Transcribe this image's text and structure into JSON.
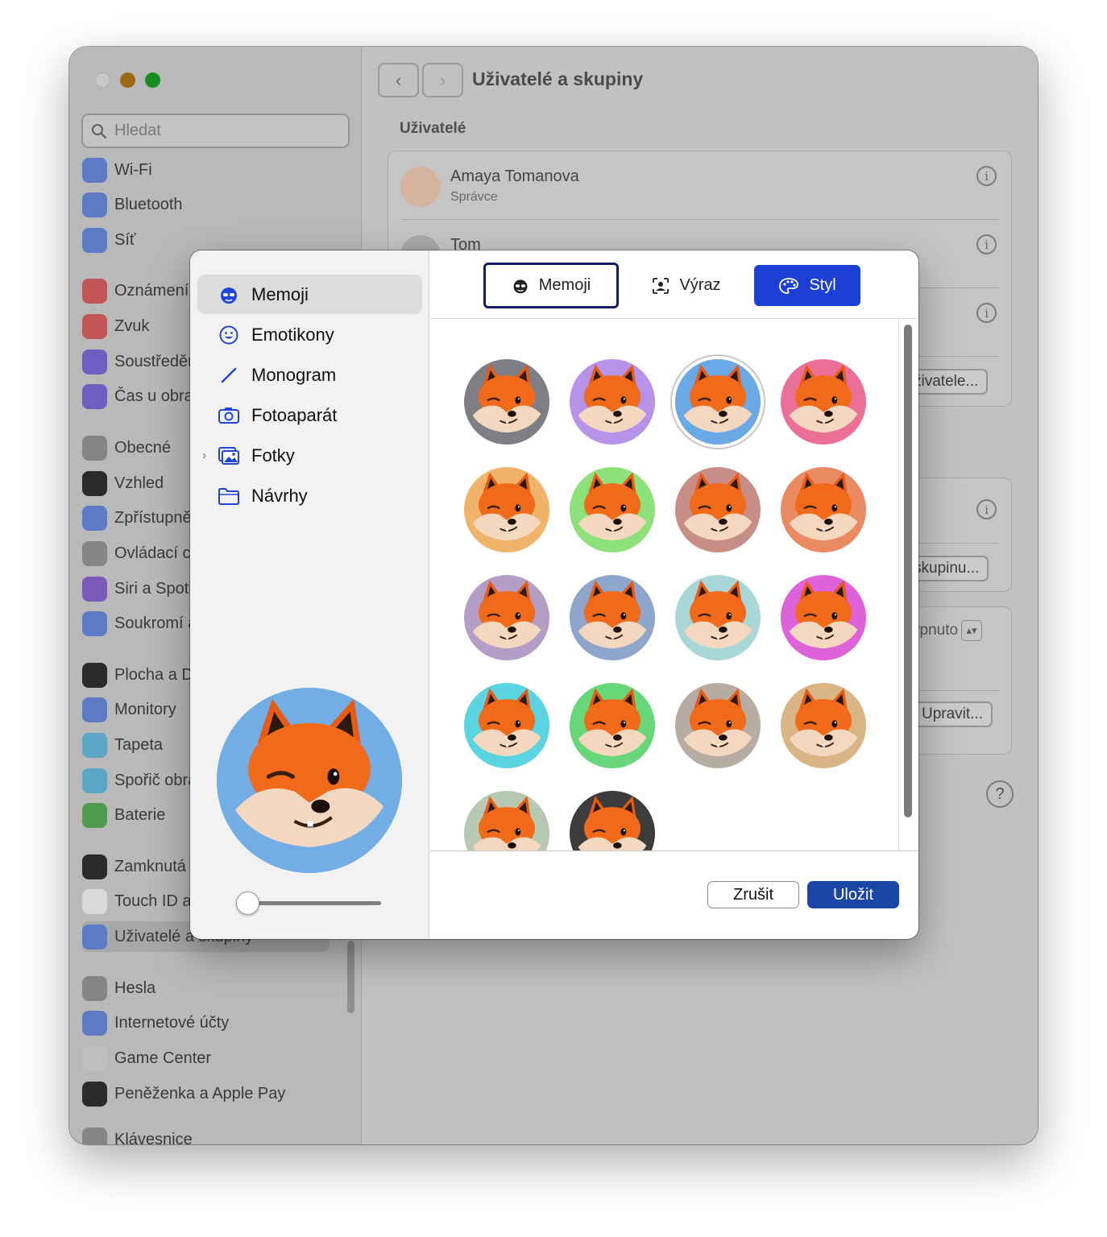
{
  "window": {
    "title": "Uživatelé a skupiny",
    "search_placeholder": "Hledat"
  },
  "sidebar": {
    "items": [
      {
        "label": "Wi-Fi",
        "icon": "wifi-icon",
        "color": "#5b7cc4"
      },
      {
        "label": "Bluetooth",
        "icon": "bluetooth-icon",
        "color": "#5b7cc4"
      },
      {
        "label": "Síť",
        "icon": "globe-icon",
        "color": "#5b7cc4"
      },
      {
        "label": "Oznámení",
        "icon": "bell-icon",
        "color": "#c25555"
      },
      {
        "label": "Zvuk",
        "icon": "speaker-icon",
        "color": "#c25555"
      },
      {
        "label": "Soustředění",
        "icon": "moon-icon",
        "color": "#6e5ebf"
      },
      {
        "label": "Čas u obrazovky",
        "icon": "hourglass-icon",
        "color": "#6e5ebf"
      },
      {
        "label": "Obecné",
        "icon": "gear-icon",
        "color": "#858585"
      },
      {
        "label": "Vzhled",
        "icon": "appearance-icon",
        "color": "#2a2a2a"
      },
      {
        "label": "Zpřístupnění",
        "icon": "accessibility-icon",
        "color": "#5b7cc4"
      },
      {
        "label": "Ovládací centrum",
        "icon": "switches-icon",
        "color": "#858585"
      },
      {
        "label": "Siri a Spotlight",
        "icon": "siri-icon",
        "color": "#7a5ab8"
      },
      {
        "label": "Soukromí a zabezpečení",
        "icon": "hand-icon",
        "color": "#5b7cc4"
      },
      {
        "label": "Plocha a Dock",
        "icon": "dock-icon",
        "color": "#2a2a2a"
      },
      {
        "label": "Monitory",
        "icon": "sun-icon",
        "color": "#5b7cc4"
      },
      {
        "label": "Tapeta",
        "icon": "flower-icon",
        "color": "#5aa6c4"
      },
      {
        "label": "Spořič obrazovky",
        "icon": "screensaver-icon",
        "color": "#5aa6c4"
      },
      {
        "label": "Baterie",
        "icon": "battery-icon",
        "color": "#4f9a4f"
      },
      {
        "label": "Zamknutá obrazovka",
        "icon": "lock-icon",
        "color": "#2a2a2a"
      },
      {
        "label": "Touch ID a heslo",
        "icon": "fingerprint-icon",
        "color": "#d9d9d9"
      },
      {
        "label": "Uživatelé a skupiny",
        "icon": "users-icon",
        "color": "#5b7cc4"
      },
      {
        "label": "Hesla",
        "icon": "key-icon",
        "color": "#858585"
      },
      {
        "label": "Internetové účty",
        "icon": "at-icon",
        "color": "#5b7cc4"
      },
      {
        "label": "Game Center",
        "icon": "game-center-icon",
        "color": "#bfbfbf"
      },
      {
        "label": "Peněženka a Apple Pay",
        "icon": "wallet-icon",
        "color": "#2a2a2a"
      },
      {
        "label": "Klávesnice",
        "icon": "keyboard-icon",
        "color": "#858585"
      }
    ]
  },
  "content": {
    "section_label": "Uživatelé",
    "users": [
      {
        "name": "Amaya Tomanova",
        "role": "Správce"
      },
      {
        "name": "Tom",
        "role": ""
      }
    ],
    "peek_buttons": {
      "add_user": "živatele...",
      "add_group": "skupinu...",
      "auto_login": "ypnuto",
      "edit": "Upravit..."
    }
  },
  "modal": {
    "categories": [
      {
        "label": "Memoji",
        "icon": "memoji-icon"
      },
      {
        "label": "Emotikony",
        "icon": "smiley-icon"
      },
      {
        "label": "Monogram",
        "icon": "pencil-icon"
      },
      {
        "label": "Fotoaparát",
        "icon": "camera-icon"
      },
      {
        "label": "Fotky",
        "icon": "photos-icon"
      },
      {
        "label": "Návrhy",
        "icon": "folder-icon"
      }
    ],
    "tabs": {
      "memoji": "Memoji",
      "expression": "Výraz",
      "style": "Styl"
    },
    "backgrounds": [
      "#7d7f85",
      "#b693e8",
      "#6aa8e6",
      "#eb6f97",
      "#efb469",
      "#8ee07a",
      "#c88e86",
      "#e98a62",
      "#b49ec5",
      "#8ea6cb",
      "#a9d7d8",
      "#de63da",
      "#59d4e0",
      "#67d77a",
      "#b7aca2",
      "#d9b586",
      "#b7c9b1",
      "#3c3c3c"
    ],
    "preview_background": "#72aee5",
    "selected_index": 2,
    "cancel_label": "Zrušit",
    "save_label": "Uložit"
  }
}
